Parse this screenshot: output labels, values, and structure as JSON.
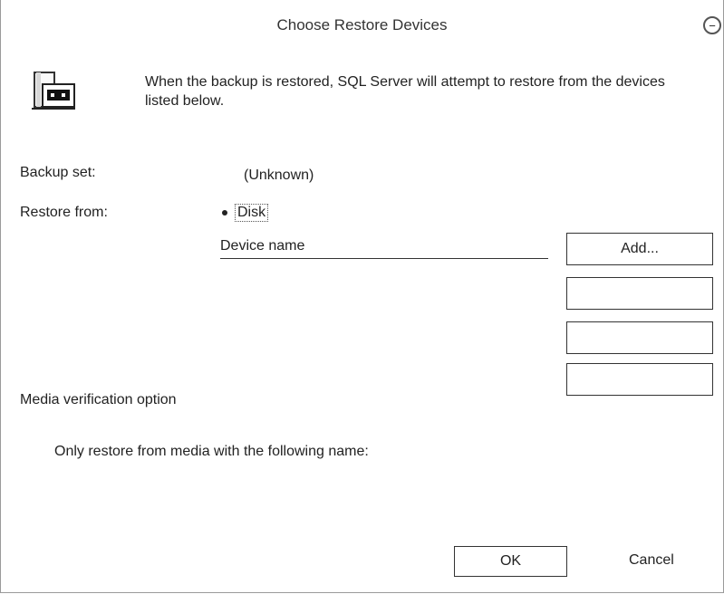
{
  "dialog": {
    "title": "Choose Restore Devices",
    "icon_name": "backup-device-icon",
    "intro_text": "When the backup is restored, SQL Server will attempt to restore from the devices listed below."
  },
  "fields": {
    "backup_set_label": "Backup set:",
    "backup_set_value": "(Unknown)",
    "restore_from_label": "Restore from:",
    "restore_from_option": "Disk"
  },
  "devices": {
    "header": "Device name",
    "add_button": "Add...",
    "extra_buttons": [
      "",
      "",
      ""
    ]
  },
  "media": {
    "section_label": "Media verification option",
    "name_label": "Only restore from media with the following name:"
  },
  "actions": {
    "ok": "OK",
    "cancel": "Cancel"
  }
}
